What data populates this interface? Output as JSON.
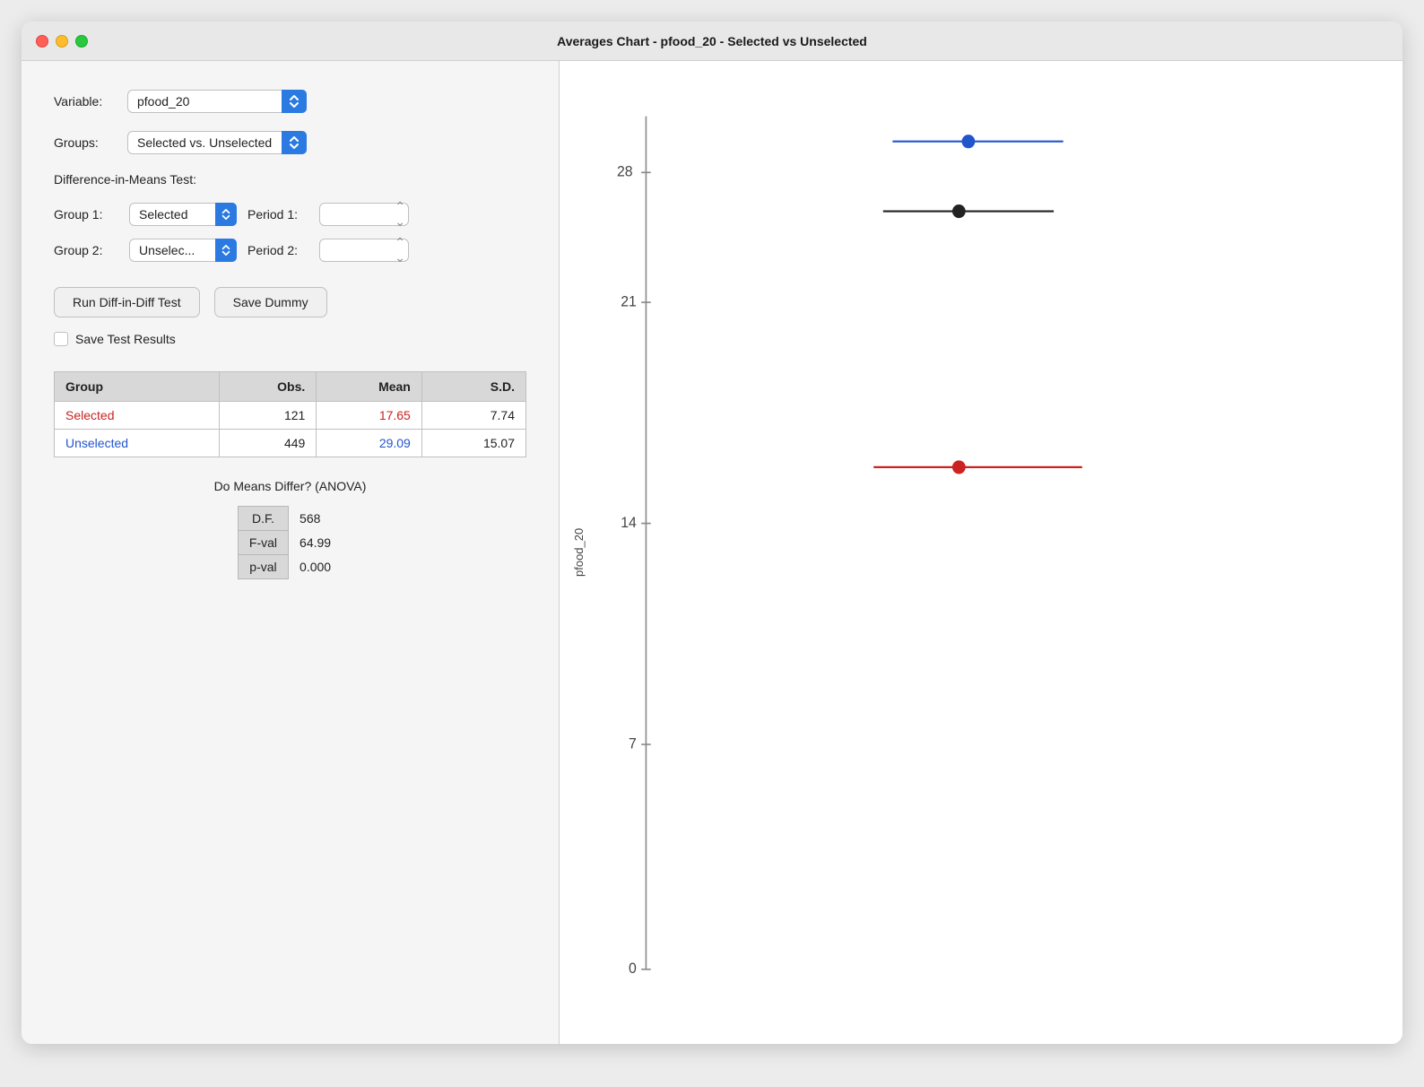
{
  "window": {
    "title": "Averages Chart - pfood_20 - Selected vs Unselected"
  },
  "sidebar": {
    "variable_label": "Variable:",
    "variable_value": "pfood_20",
    "groups_label": "Groups:",
    "groups_value": "Selected vs. Unselected",
    "diff_section_title": "Difference-in-Means Test:",
    "group1_label": "Group 1:",
    "group1_value": "Selected",
    "period1_label": "Period 1:",
    "period1_value": "",
    "group2_label": "Group 2:",
    "group2_value": "Unselec...",
    "period2_label": "Period 2:",
    "period2_value": "",
    "run_diff_button": "Run Diff-in-Diff Test",
    "save_dummy_button": "Save Dummy",
    "save_results_label": "Save Test Results"
  },
  "table": {
    "headers": [
      "Group",
      "Obs.",
      "Mean",
      "S.D."
    ],
    "rows": [
      {
        "group": "Selected",
        "obs": "121",
        "mean": "17.65",
        "sd": "7.74",
        "type": "selected"
      },
      {
        "group": "Unselected",
        "obs": "449",
        "mean": "29.09",
        "sd": "15.07",
        "type": "unselected"
      }
    ]
  },
  "anova": {
    "title": "Do Means Differ? (ANOVA)",
    "rows": [
      {
        "label": "D.F.",
        "value": "568"
      },
      {
        "label": "F-val",
        "value": "64.99"
      },
      {
        "label": "p-val",
        "value": "0.000"
      }
    ]
  },
  "chart": {
    "y_label": "pfood_20",
    "y_ticks": [
      "0",
      "7",
      "14",
      "21",
      "28"
    ],
    "points": [
      {
        "color": "#2255cc",
        "y_pct": 0.88,
        "err_left": 0.04,
        "err_right": 0.025
      },
      {
        "color": "#222222",
        "y_pct": 0.8,
        "err_left": 0.04,
        "err_right": 0.04
      },
      {
        "color": "#cc2222",
        "y_pct": 0.46,
        "err_left": 0.04,
        "err_right": 0.06
      }
    ]
  }
}
